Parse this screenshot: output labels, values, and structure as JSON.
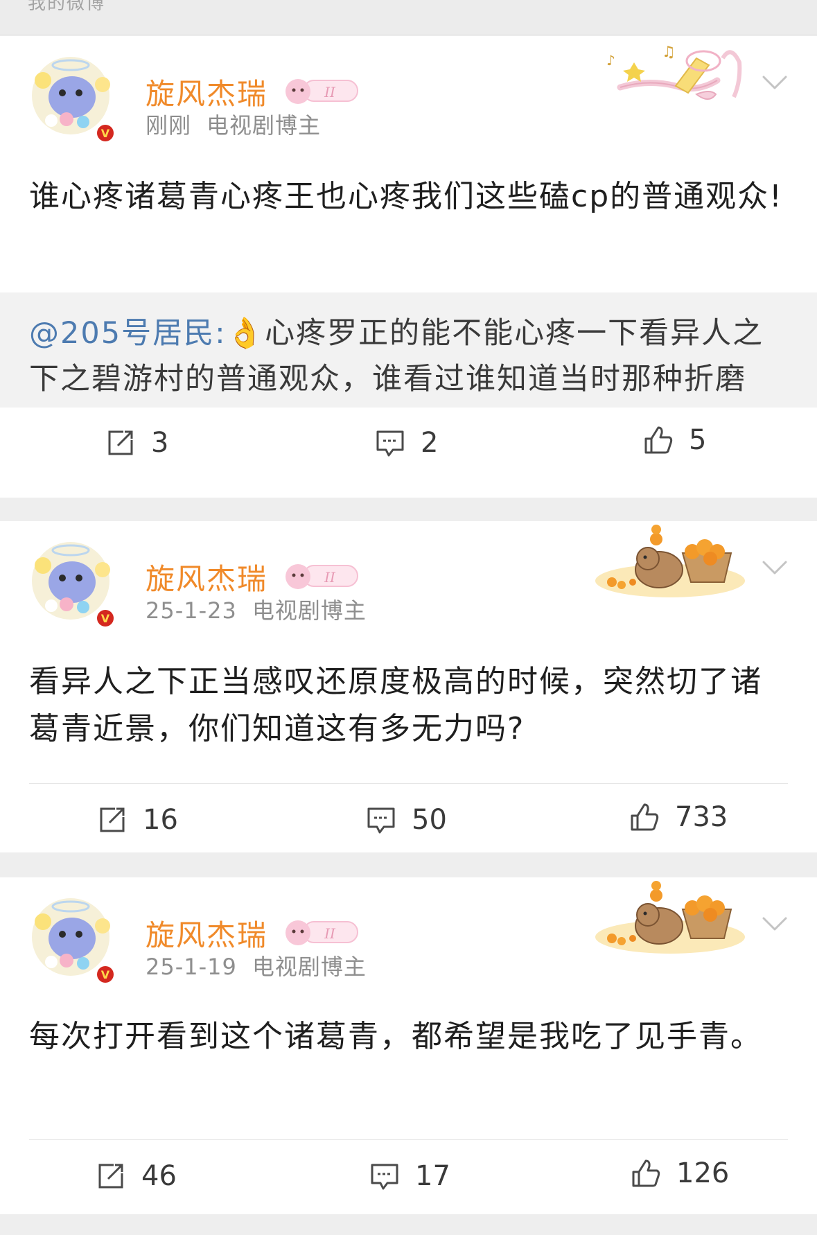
{
  "header": {
    "partial_text": "我的微博"
  },
  "posts": [
    {
      "author": "旋风杰瑞",
      "time": "刚刚",
      "tag": "电视剧博主",
      "text": "谁心疼诸葛青心疼王也心疼我们这些磕cp的普通观众!",
      "quote": {
        "mention": "@205号居民:",
        "emoji": "👌",
        "text": "心疼罗正的能不能心疼一下看异人之下之碧游村的普通观众，谁看过谁知道当时那种折磨"
      },
      "actions": {
        "repost": "3",
        "comment": "2",
        "like": "5"
      }
    },
    {
      "author": "旋风杰瑞",
      "time": "25-1-23",
      "tag": "电视剧博主",
      "text": "看异人之下正当感叹还原度极高的时候，突然切了诸葛青近景，你们知道这有多无力吗?",
      "actions": {
        "repost": "16",
        "comment": "50",
        "like": "733"
      }
    },
    {
      "author": "旋风杰瑞",
      "time": "25-1-19",
      "tag": "电视剧博主",
      "text": "每次打开看到这个诸葛青，都希望是我吃了见手青。",
      "actions": {
        "repost": "46",
        "comment": "17",
        "like": "126"
      }
    }
  ],
  "colors": {
    "author": "#f08a2a",
    "mention": "#4d7bb0",
    "meta": "#8e8e8e",
    "page_bg": "#eeeeee",
    "quote_bg": "#f2f2f2"
  },
  "icons": [
    "repost-icon",
    "comment-icon",
    "like-icon",
    "chevron-down-icon",
    "verified-badge-icon",
    "level-badge-icon"
  ]
}
